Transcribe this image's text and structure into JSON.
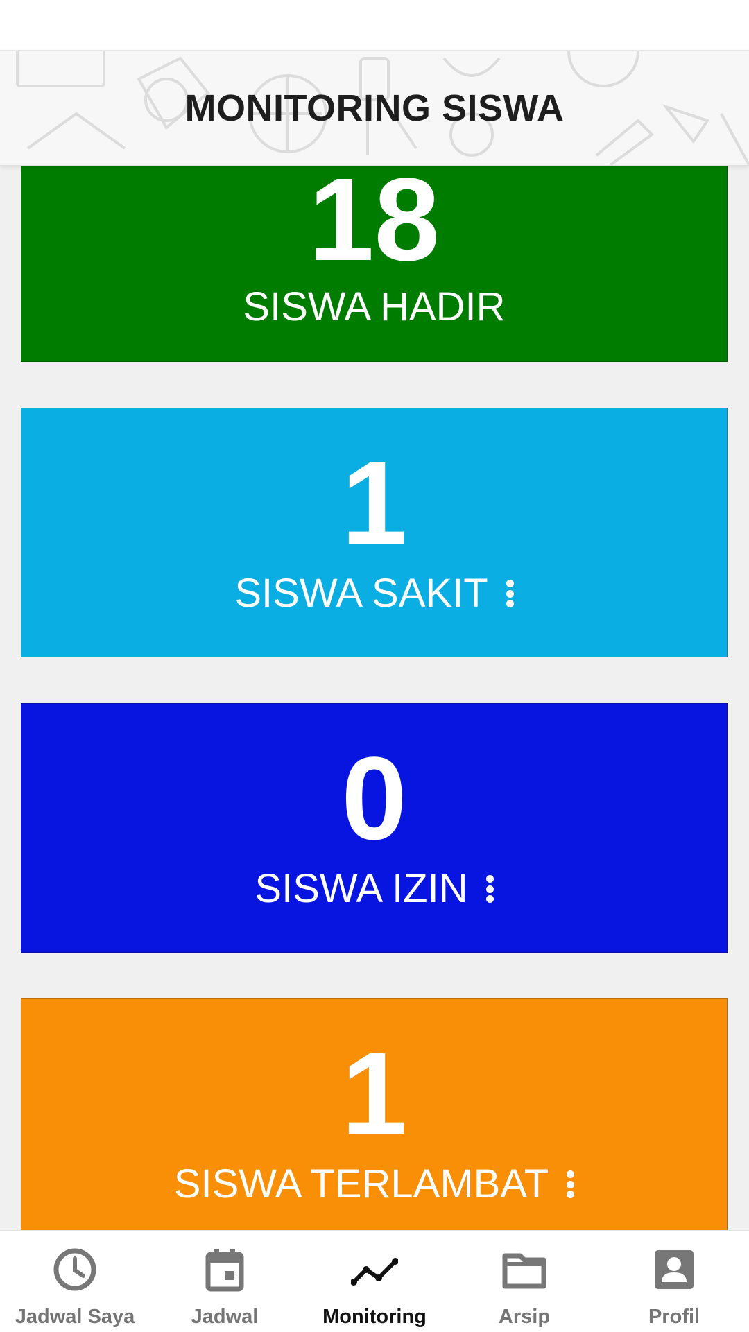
{
  "header": {
    "title": "MONITORING SISWA"
  },
  "cards": [
    {
      "value": "18",
      "label": "SISWA HADIR",
      "color": "#007c00",
      "has_menu": false
    },
    {
      "value": "1",
      "label": "SISWA SAKIT",
      "color": "#0baee3",
      "has_menu": true
    },
    {
      "value": "0",
      "label": "SISWA IZIN",
      "color": "#0814e0",
      "has_menu": true
    },
    {
      "value": "1",
      "label": "SISWA TERLAMBAT",
      "color": "#f98f06",
      "has_menu": true
    }
  ],
  "bottom_nav": {
    "items": [
      {
        "label": "Jadwal Saya",
        "icon": "clock-icon",
        "active": false
      },
      {
        "label": "Jadwal",
        "icon": "calendar-icon",
        "active": false
      },
      {
        "label": "Monitoring",
        "icon": "trend-line-icon",
        "active": true
      },
      {
        "label": "Arsip",
        "icon": "folder-icon",
        "active": false
      },
      {
        "label": "Profil",
        "icon": "profile-icon",
        "active": false
      }
    ]
  },
  "colors": {
    "active_nav": "#111111",
    "inactive_nav": "#757575",
    "background": "#f0f0f0"
  }
}
